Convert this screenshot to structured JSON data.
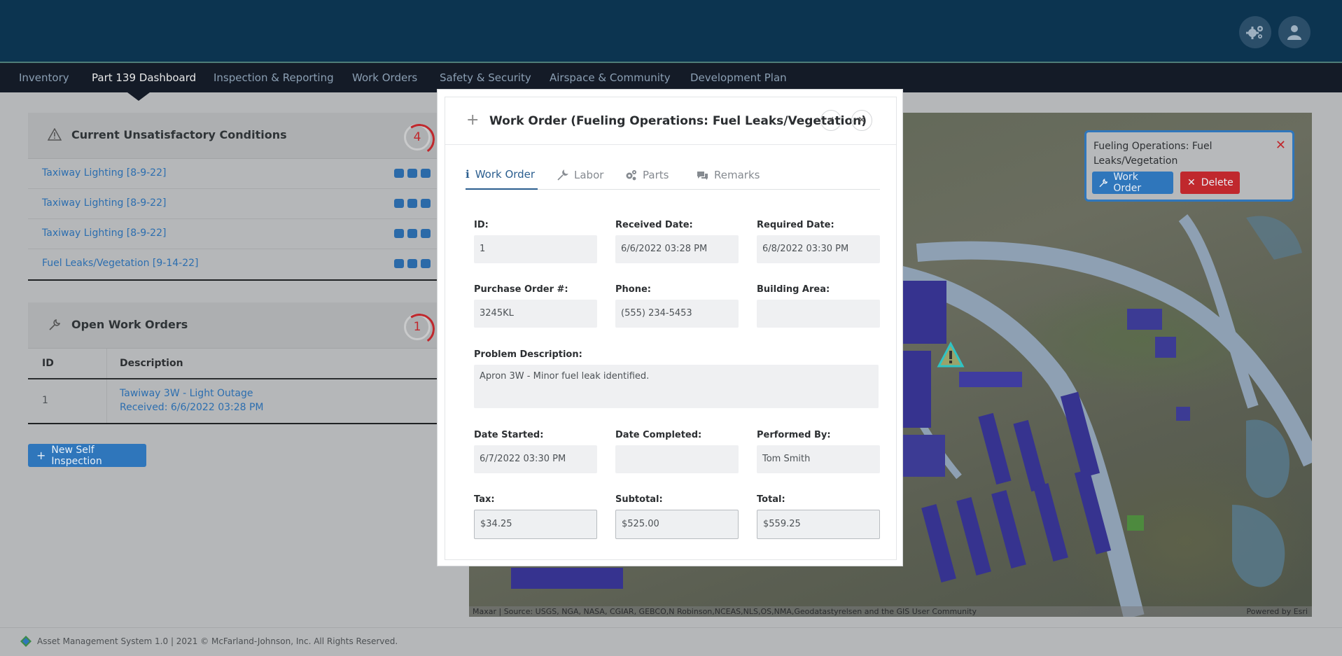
{
  "nav": {
    "items": [
      "Inventory",
      "Part 139 Dashboard",
      "Inspection & Reporting",
      "Work Orders",
      "Safety & Security",
      "Airspace & Community",
      "Development Plan"
    ],
    "active": "Part 139 Dashboard"
  },
  "conditions": {
    "title": "Current Unsatisfactory Conditions",
    "count": "4",
    "rows": [
      {
        "name": "Taxiway Lighting",
        "date": "[8-9-22]"
      },
      {
        "name": "Taxiway Lighting",
        "date": "[8-9-22]"
      },
      {
        "name": "Taxiway Lighting",
        "date": "[8-9-22]"
      },
      {
        "name": "Fuel Leaks/Vegetation",
        "date": "[9-14-22]"
      }
    ]
  },
  "work_orders_panel": {
    "title": "Open Work Orders",
    "count": "1",
    "columns": [
      "ID",
      "Description"
    ],
    "rows": [
      {
        "id": "1",
        "desc": "Tawiway 3W - Light Outage",
        "received": "Received: 6/6/2022 03:28 PM"
      }
    ]
  },
  "new_inspection_label": "New Self Inspection",
  "map": {
    "attribution": "Maxar | Source: USGS, NGA, NASA, CGIAR, GEBCO,N Robinson,NCEAS,NLS,OS,NMA,Geodatastyrelsen and the GIS User Community",
    "powered_by": "Powered by Esri"
  },
  "popup": {
    "title": "Fueling Operations: Fuel Leaks/Vegetation",
    "work_order_label": "Work Order",
    "delete_label": "Delete"
  },
  "footer": {
    "text": "Asset Management System 1.0 | 2021 © McFarland-Johnson, Inc. All Rights Reserved."
  },
  "modal": {
    "title": "Work Order (Fueling Operations: Fuel Leaks/Vegetation)",
    "tabs": [
      "Work Order",
      "Labor",
      "Parts",
      "Remarks"
    ],
    "active_tab": "Work Order",
    "fields": {
      "id": {
        "label": "ID:",
        "value": "1"
      },
      "received": {
        "label": "Received Date:",
        "value": "6/6/2022 03:28 PM"
      },
      "required": {
        "label": "Required Date:",
        "value": "6/8/2022 03:30 PM"
      },
      "po": {
        "label": "Purchase Order #:",
        "value": "3245KL"
      },
      "phone": {
        "label": "Phone:",
        "value": "(555) 234-5453"
      },
      "building": {
        "label": "Building Area:",
        "value": ""
      },
      "problem": {
        "label": "Problem Description:",
        "value": "Apron 3W - Minor fuel leak identified."
      },
      "started": {
        "label": "Date Started:",
        "value": "6/7/2022 03:30 PM"
      },
      "completed": {
        "label": "Date Completed:",
        "value": ""
      },
      "performed": {
        "label": "Performed By:",
        "value": "Tom Smith"
      },
      "tax": {
        "label": "Tax:",
        "value": "$34.25"
      },
      "subtotal": {
        "label": "Subtotal:",
        "value": "$525.00"
      },
      "total": {
        "label": "Total:",
        "value": "$559.25"
      }
    }
  },
  "colors": {
    "header": "#0c3450",
    "nav": "#141b27",
    "accent": "#2f76bb",
    "danger": "#c0282d"
  }
}
